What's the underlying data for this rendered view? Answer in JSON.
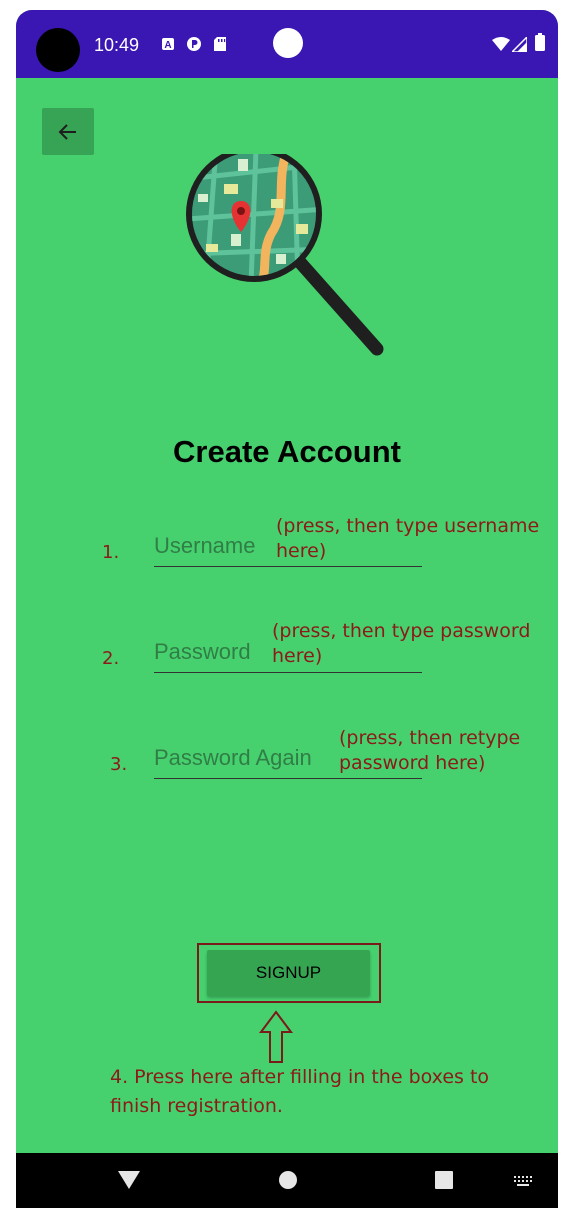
{
  "status_bar": {
    "time": "10:49",
    "background": "#3a17b3"
  },
  "screen": {
    "background": "#47d16e",
    "title": "Create Account"
  },
  "form": {
    "fields": [
      {
        "number": "1.",
        "placeholder": "Username",
        "hint_line1": "(press, then type username",
        "hint_line2": "here)"
      },
      {
        "number": "2.",
        "placeholder": "Password",
        "hint_line1": "(press, then type password",
        "hint_line2": "here)"
      },
      {
        "number": "3.",
        "placeholder": "Password Again",
        "hint_line1": "(press, then retype",
        "hint_line2": "password here)"
      }
    ],
    "signup_label": "SIGNUP",
    "instruction_line1": "4. Press here after filling in the boxes to",
    "instruction_line2": "finish registration."
  },
  "colors": {
    "annotation": "#8b1a1a",
    "button": "#36a552"
  }
}
